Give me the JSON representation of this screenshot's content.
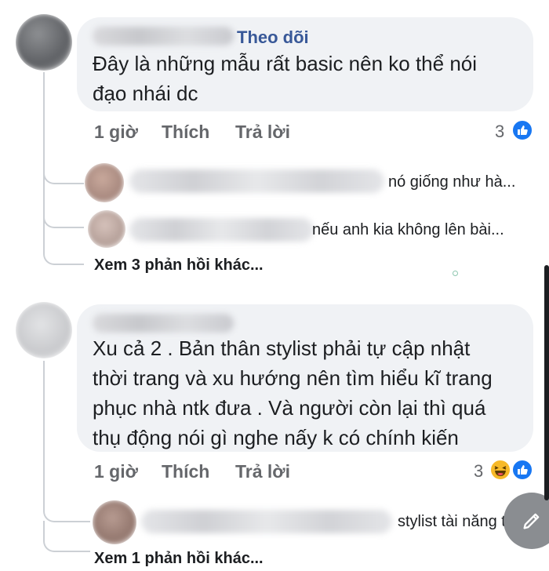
{
  "comments": [
    {
      "follow_label": "Theo dõi",
      "text_line1": "Đây là những mẫu rất basic nên ko thể nói",
      "text_line2": "đạo nhái dc",
      "time": "1 giờ",
      "like_label": "Thích",
      "reply_label": "Trả lời",
      "reaction_count": "3",
      "replies": [
        {
          "snippet": "nó giống như hà..."
        },
        {
          "snippet": "nếu anh kia không lên bài..."
        }
      ],
      "more_replies": "Xem 3 phản hồi khác..."
    },
    {
      "text_line1": "Xu cả 2 . Bản thân stylist phải tự cập nhật",
      "text_line2": "thời trang và xu hướng nên tìm hiểu kĩ trang",
      "text_line3": "phục nhà ntk đưa . Và người còn lại thì quá",
      "text_line4": "thụ động nói gì nghe nấy k có chính kiến",
      "time": "1 giờ",
      "like_label": "Thích",
      "reply_label": "Trả lời",
      "reaction_count": "3",
      "replies": [
        {
          "snippet": "stylist tài năng t..."
        }
      ],
      "more_replies": "Xem 1 phản hồi khác..."
    }
  ],
  "colors": {
    "link": "#385898",
    "like_blue": "#1877f2",
    "haha_yellow": "#f7b928",
    "bubble": "#f0f2f5"
  },
  "icons": [
    "like-icon",
    "haha-icon",
    "edit-pencil-icon"
  ]
}
